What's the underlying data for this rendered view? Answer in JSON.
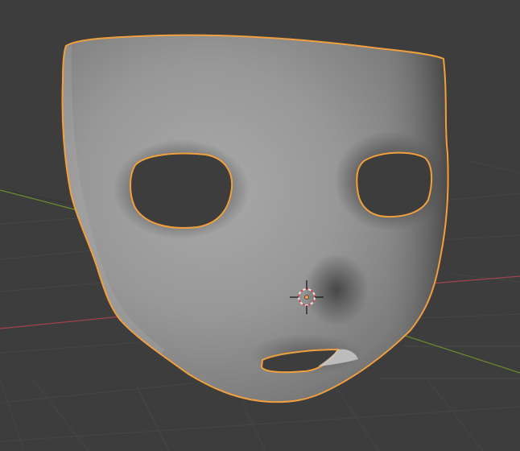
{
  "app": "3d-viewport",
  "scene": {
    "background_color": "#3d3d3d",
    "grid_color": "#474747",
    "axis_x_color": "#a8424f",
    "axis_y_color": "#6b8d2c",
    "selected_object": {
      "name_icon": "mask-mesh",
      "shade_color": "#9a9a9a",
      "outline_color": "#f2a03d",
      "selected": true
    },
    "origin_point_color": "#f29d3a",
    "cursor_ring_colors": [
      "#e8e8e8",
      "#d9474c"
    ]
  }
}
